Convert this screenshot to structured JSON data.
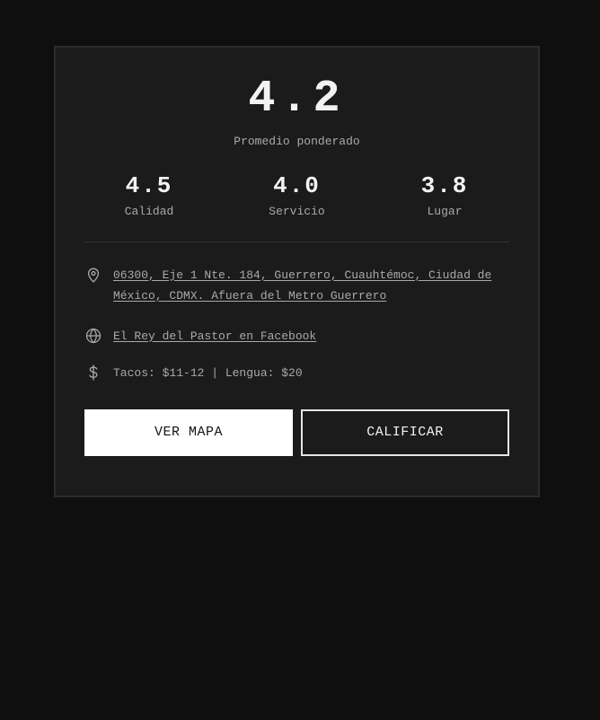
{
  "rating": {
    "overall": "4.2",
    "overall_label": "Promedio ponderado"
  },
  "metrics": [
    {
      "value": "4.5",
      "label": "Calidad"
    },
    {
      "value": "4.0",
      "label": "Servicio"
    },
    {
      "value": "3.8",
      "label": "Lugar"
    }
  ],
  "info": {
    "address": "06300, Eje 1 Nte. 184, Guerrero, Cuauhtémoc, Ciudad de México, CDMX. Afuera del Metro Guerrero",
    "facebook_link": "El Rey del Pastor en Facebook",
    "prices": "Tacos: $11-12 | Lengua: $20"
  },
  "actions": {
    "map_label": "VER MAPA",
    "rate_label": "CALIFICAR"
  },
  "icons": {
    "address": "map-pin-icon",
    "facebook": "globe-icon",
    "prices": "dollar-icon"
  },
  "colors": {
    "page_background": "#0f0f0f",
    "card_background": "#1b1b1b",
    "primary_text": "#f2f2f2",
    "secondary_text": "#a9a9a9",
    "primary_button": "#ffffff"
  }
}
